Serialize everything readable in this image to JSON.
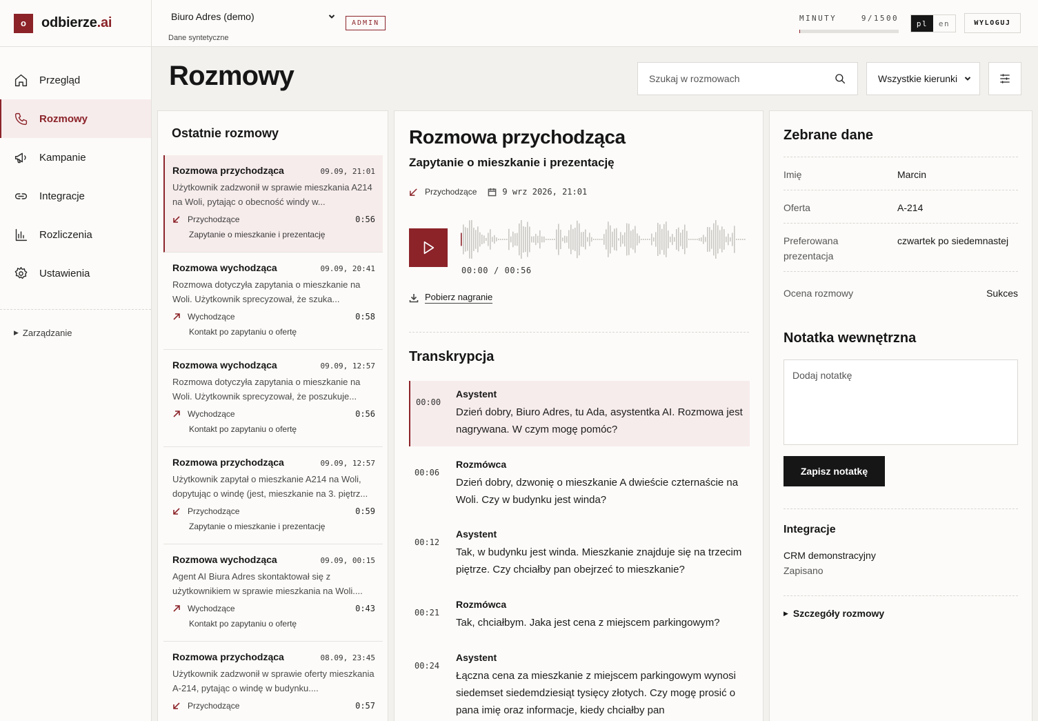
{
  "brand": {
    "mark": "o",
    "name": "odbierze",
    "suffix": ".ai"
  },
  "nav": {
    "items": [
      {
        "label": "Przegląd"
      },
      {
        "label": "Rozmowy"
      },
      {
        "label": "Kampanie"
      },
      {
        "label": "Integracje"
      },
      {
        "label": "Rozliczenia"
      },
      {
        "label": "Ustawienia"
      }
    ],
    "manage": "Zarządzanie"
  },
  "topbar": {
    "office": "Biuro Adres (demo)",
    "office_sub": "Dane syntetyczne",
    "admin": "ADMIN",
    "minutes_label": "MINUTY",
    "minutes_value": "9/1500",
    "minutes_used_fraction": 0.006,
    "lang_on": "pl",
    "lang_off": "en",
    "logout": "WYLOGUJ"
  },
  "page": {
    "title": "Rozmowy",
    "search_placeholder": "Szukaj w rozmowach",
    "direction_filter": "Wszystkie kierunki"
  },
  "list": {
    "title": "Ostatnie rozmowy",
    "calls": [
      {
        "title": "Rozmowa przychodząca",
        "time": "09.09, 21:01",
        "summary": "Użytkownik zadzwonił w sprawie mieszkania A214 na Woli, pytając o obecność windy w...",
        "direction": "Przychodzące",
        "duration": "0:56",
        "topic": "Zapytanie o mieszkanie i prezentację"
      },
      {
        "title": "Rozmowa wychodząca",
        "time": "09.09, 20:41",
        "summary": "Rozmowa dotyczyła zapytania o mieszkanie na Woli. Użytkownik sprecyzował, że szuka...",
        "direction": "Wychodzące",
        "duration": "0:58",
        "topic": "Kontakt po zapytaniu o ofertę"
      },
      {
        "title": "Rozmowa wychodząca",
        "time": "09.09, 12:57",
        "summary": "Rozmowa dotyczyła zapytania o mieszkanie na Woli. Użytkownik sprecyzował, że poszukuje...",
        "direction": "Wychodzące",
        "duration": "0:56",
        "topic": "Kontakt po zapytaniu o ofertę"
      },
      {
        "title": "Rozmowa przychodząca",
        "time": "09.09, 12:57",
        "summary": "Użytkownik zapytał o mieszkanie A214 na Woli, dopytując o windę (jest, mieszkanie na 3. piętrz...",
        "direction": "Przychodzące",
        "duration": "0:59",
        "topic": "Zapytanie o mieszkanie i prezentację"
      },
      {
        "title": "Rozmowa wychodząca",
        "time": "09.09, 00:15",
        "summary": "Agent AI Biura Adres skontaktował się z użytkownikiem w sprawie mieszkania na Woli....",
        "direction": "Wychodzące",
        "duration": "0:43",
        "topic": "Kontakt po zapytaniu o ofertę"
      },
      {
        "title": "Rozmowa przychodząca",
        "time": "08.09, 23:45",
        "summary": "Użytkownik zadzwonił w sprawie oferty mieszkania A-214, pytając o windę w budynku....",
        "direction": "Przychodzące",
        "duration": "0:57",
        "topic": ""
      }
    ]
  },
  "detail": {
    "title": "Rozmowa przychodząca",
    "subtitle": "Zapytanie o mieszkanie i prezentację",
    "direction": "Przychodzące",
    "date": "9 wrz 2026, 21:01",
    "audio_time": "00:00  /  00:56",
    "download": "Pobierz nagranie",
    "transcript_title": "Transkrypcja",
    "transcript": [
      {
        "time": "00:00",
        "speaker": "Asystent",
        "text": "Dzień dobry, Biuro Adres, tu Ada, asystentka AI. Rozmowa jest nagrywana. W czym mogę pomóc?"
      },
      {
        "time": "00:06",
        "speaker": "Rozmówca",
        "text": "Dzień dobry, dzwonię o mieszkanie A dwieście czternaście na Woli. Czy w budynku jest winda?"
      },
      {
        "time": "00:12",
        "speaker": "Asystent",
        "text": "Tak, w budynku jest winda. Mieszkanie znajduje się na trzecim piętrze. Czy chciałby pan obejrzeć to mieszkanie?"
      },
      {
        "time": "00:21",
        "speaker": "Rozmówca",
        "text": "Tak, chciałbym. Jaka jest cena z miejscem parkingowym?"
      },
      {
        "time": "00:24",
        "speaker": "Asystent",
        "text": "Łączna cena za mieszkanie z miejscem parkingowym wynosi siedemset siedemdziesiąt tysięcy złotych. Czy mogę prosić o pana imię oraz informacje, kiedy chciałby pan"
      }
    ]
  },
  "collected": {
    "title": "Zebrane dane",
    "fields": [
      {
        "key": "Imię",
        "value": "Marcin"
      },
      {
        "key": "Oferta",
        "value": "A-214"
      },
      {
        "key": "Preferowana prezentacja",
        "value": "czwartek po siedemnastej"
      },
      {
        "key": "Ocena rozmowy",
        "value": "Sukces"
      }
    ],
    "note_title": "Notatka wewnętrzna",
    "note_placeholder": "Dodaj notatkę",
    "save_label": "Zapisz notatkę",
    "integrations_title": "Integracje",
    "integration_name": "CRM demonstracyjny",
    "integration_status": "Zapisano",
    "details_label": "Szczegóły rozmowy"
  },
  "colors": {
    "accent": "#8b2329",
    "dark": "#161616"
  }
}
